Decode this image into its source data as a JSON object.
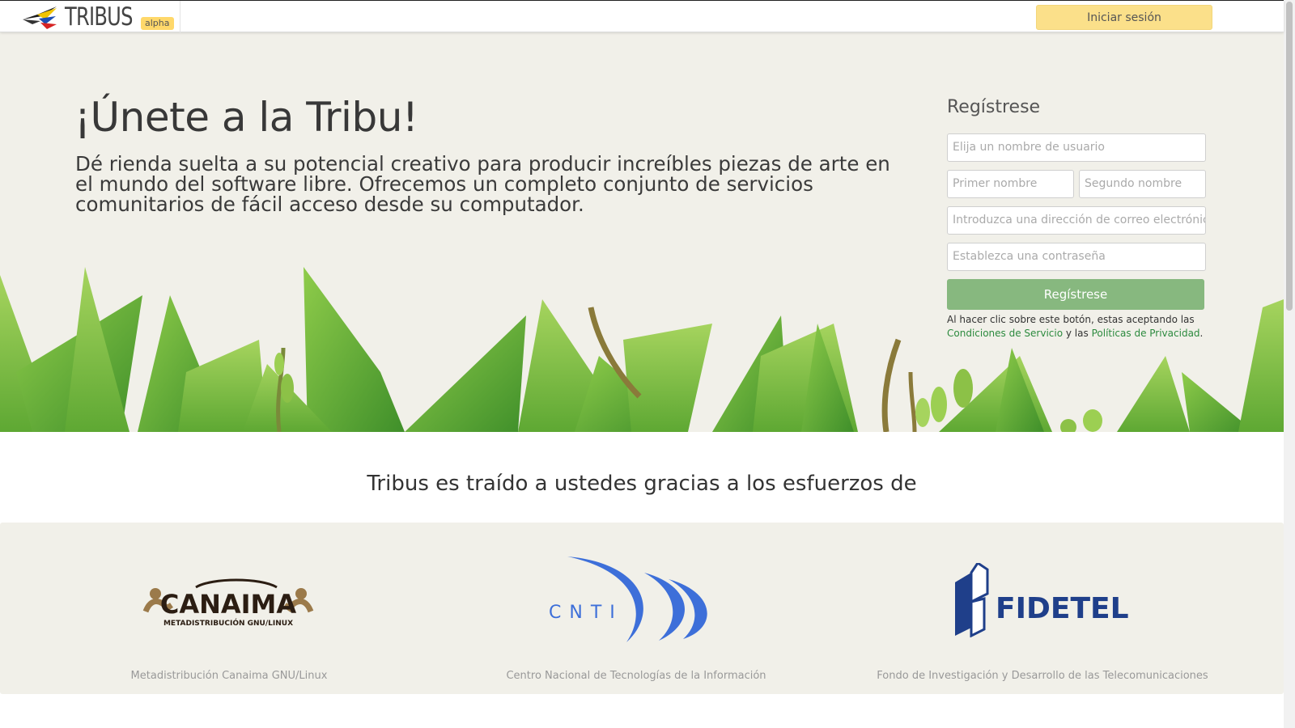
{
  "navbar": {
    "brand_name": "TRIBUS",
    "badge": "alpha",
    "login_label": "Iniciar sesión"
  },
  "hero": {
    "title": "¡Únete a la Tribu!",
    "description": "Dé rienda suelta a su potencial creativo para producir increíbles piezas de arte en el mundo del software libre. Ofrecemos un completo conjunto de servicios comunitarios de fácil acceso desde su computador."
  },
  "signup": {
    "title": "Regístrese",
    "username_placeholder": "Elija un nombre de usuario",
    "first_name_placeholder": "Primer nombre",
    "last_name_placeholder": "Segundo nombre",
    "email_placeholder": "Introduzca una dirección de correo electrónico",
    "password_placeholder": "Establezca una contraseña",
    "submit_label": "Regístrese",
    "terms_prefix": "Al hacer clic sobre este botón, estas aceptando las",
    "terms_link": "Condiciones de Servicio",
    "terms_middle": "y las",
    "privacy_link": "Políticas de Privacidad",
    "terms_suffix": "."
  },
  "sponsors": {
    "title": "Tribus es traído a ustedes gracias a los esfuerzos de",
    "items": [
      {
        "logo_text": "CANAIMA",
        "logo_subtext": "METADISTRIBUCIÓN GNU/LINUX",
        "caption": "Metadistribución Canaima GNU/Linux"
      },
      {
        "logo_text": "CNTI",
        "caption": "Centro Nacional de Tecnologías de la Información"
      },
      {
        "logo_text": "FIDETEL",
        "caption": "Fondo de Investigación y Desarrollo de las Telecomunicaciones"
      }
    ]
  },
  "colors": {
    "login_button": "#fbe08a",
    "register_button": "#87b87f",
    "link": "#2c8a3e",
    "hero_background": "#f1f0e9",
    "leaf_green": "#7cc142",
    "cnti_blue": "#3d6fd9",
    "fidetel_navy": "#1f3f8a"
  }
}
